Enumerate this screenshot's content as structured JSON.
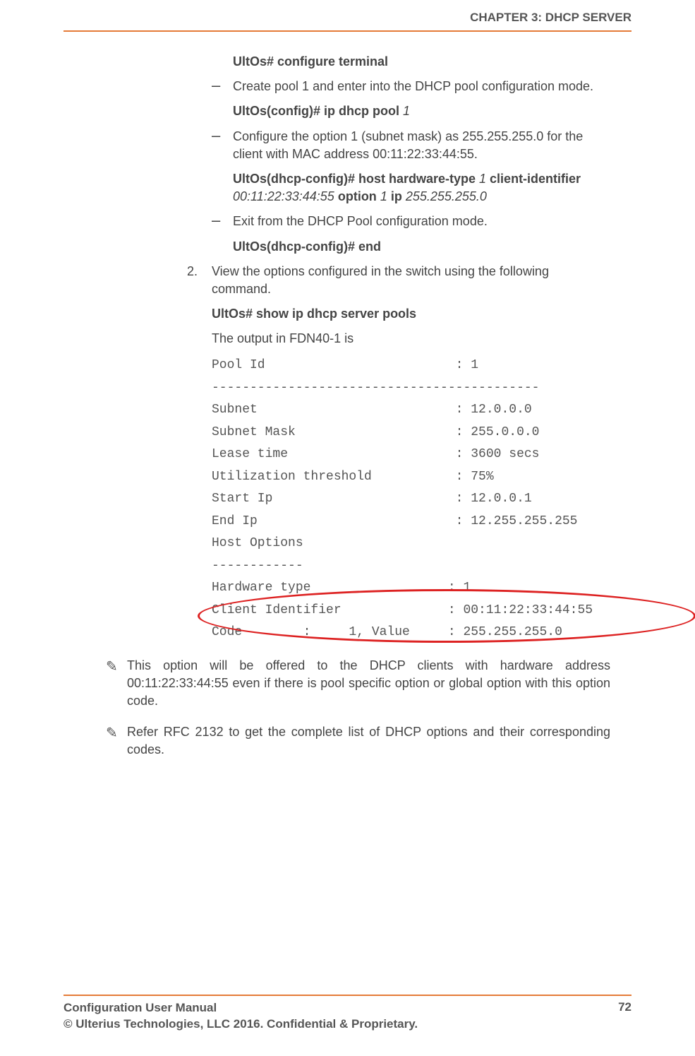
{
  "header": {
    "chapter": "CHAPTER 3: DHCP SERVER"
  },
  "body": {
    "cmd_conf_term": "UltOs# configure terminal",
    "dash1": "Create pool 1 and enter into the DHCP pool configuration mode.",
    "cmd_ippool_prefix": "UltOs(config)# ip dhcp pool ",
    "cmd_ippool_arg": "1",
    "dash2": "Configure the option 1 (subnet mask) as 255.255.255.0 for the client with MAC address 00:11:22:33:44:55.",
    "cmd_host_1": "UltOs(dhcp-config)# host hardware-type ",
    "cmd_host_1arg": "1",
    "cmd_host_2": " client-identifier ",
    "cmd_host_mac": "00:11:22:33:44:55",
    "cmd_host_sp": "   ",
    "cmd_host_3": "option ",
    "cmd_host_3arg": "1",
    "cmd_host_4": " ip ",
    "cmd_host_4arg": "255.255.255.0",
    "dash3": "Exit from the DHCP Pool configuration mode.",
    "cmd_end": "UltOs(dhcp-config)# end",
    "step2_num": "2.",
    "step2_text": "View the options configured in the switch using the following command.",
    "cmd_show": "UltOs# show ip dhcp server pools",
    "out_intro": "The output in FDN40-1 is",
    "mono": "Pool Id                         : 1\n-------------------------------------------\nSubnet                          : 12.0.0.0\nSubnet Mask                     : 255.0.0.0\nLease time                      : 3600 secs\nUtilization threshold           : 75%\nStart Ip                        : 12.0.0.1\nEnd Ip                          : 12.255.255.255\nHost Options\n------------\nHardware type                  : 1\nClient Identifier              : 00:11:22:33:44:55\nCode        :     1, Value     : 255.255.255.0",
    "note1": "This option will be offered to the DHCP clients with hardware address 00:11:22:33:44:55 even if there is pool specific option or global option with this option code.",
    "note2": "Refer RFC 2132 to get the complete list of DHCP options and their corresponding codes."
  },
  "footer": {
    "line1": "Configuration User Manual",
    "line2": "© Ulterius Technologies, LLC 2016. Confidential & Proprietary.",
    "page": "72"
  }
}
